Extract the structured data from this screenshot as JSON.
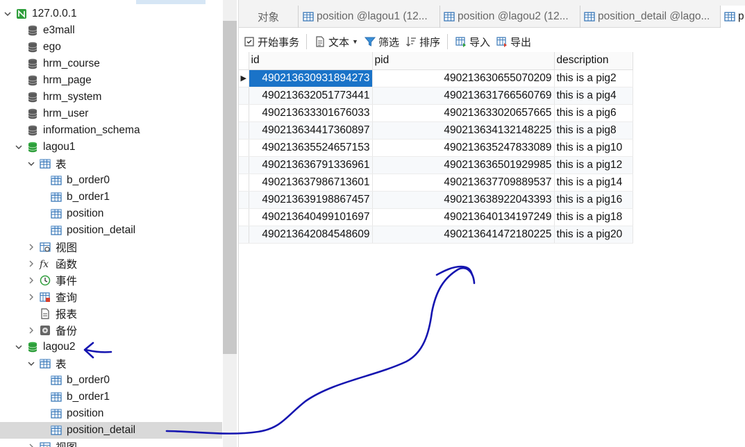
{
  "tree": {
    "connection": "127.0.0.1",
    "databases": [
      "e3mall",
      "ego",
      "hrm_course",
      "hrm_page",
      "hrm_system",
      "hrm_user",
      "information_schema"
    ],
    "lagou1": {
      "name": "lagou1",
      "tables_folder": "表",
      "tables": [
        "b_order0",
        "b_order1",
        "position",
        "position_detail"
      ],
      "views": "视图",
      "functions": "函数",
      "events": "事件",
      "queries": "查询",
      "reports": "报表",
      "backups": "备份"
    },
    "lagou2": {
      "name": "lagou2",
      "tables_folder": "表",
      "tables": [
        "b_order0",
        "b_order1",
        "position",
        "position_detail"
      ],
      "views": "视图"
    }
  },
  "tabs": [
    {
      "label": "对象"
    },
    {
      "label": "position @lagou1 (12..."
    },
    {
      "label": "position @lagou2 (12..."
    },
    {
      "label": "position_detail @lago..."
    },
    {
      "label": "p"
    }
  ],
  "toolbar": {
    "begin_transaction": "开始事务",
    "text": "文本",
    "filter": "筛选",
    "sort": "排序",
    "import": "导入",
    "export": "导出"
  },
  "grid": {
    "columns": [
      "id",
      "pid",
      "description"
    ],
    "rows": [
      [
        "490213630931894273",
        "490213630655070209",
        "this is a pig2"
      ],
      [
        "490213632051773441",
        "490213631766560769",
        "this is a pig4"
      ],
      [
        "490213633301676033",
        "490213633020657665",
        "this is a pig6"
      ],
      [
        "490213634417360897",
        "490213634132148225",
        "this is a pig8"
      ],
      [
        "490213635524657153",
        "490213635247833089",
        "this is a pig10"
      ],
      [
        "490213636791336961",
        "490213636501929985",
        "this is a pig12"
      ],
      [
        "490213637986713601",
        "490213637709889537",
        "this is a pig14"
      ],
      [
        "490213639198867457",
        "490213638922043393",
        "this is a pig16"
      ],
      [
        "490213640499101697",
        "490213640134197249",
        "this is a pig18"
      ],
      [
        "490213642084548609",
        "490213641472180225",
        "this is a pig20"
      ]
    ]
  },
  "colors": {
    "db_gray": "#5a5a5a",
    "db_green": "#2e9e3b",
    "table_blue": "#3a78b8",
    "selection": "#1a73c8",
    "annotation_ink": "#1515b0"
  }
}
